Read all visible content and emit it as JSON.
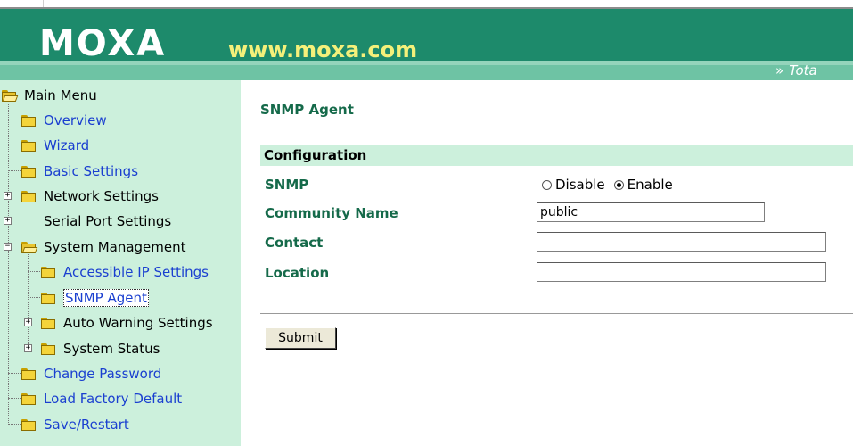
{
  "header": {
    "logo": "MOXA",
    "url": "www.moxa.com",
    "tagline": "Tota"
  },
  "sidebar": {
    "items": [
      {
        "label": "Main Menu"
      },
      {
        "label": "Overview"
      },
      {
        "label": "Wizard"
      },
      {
        "label": "Basic Settings"
      },
      {
        "label": "Network Settings"
      },
      {
        "label": "Serial Port Settings"
      },
      {
        "label": "System Management"
      },
      {
        "label": "Accessible IP Settings"
      },
      {
        "label": "SNMP Agent"
      },
      {
        "label": "Auto Warning Settings"
      },
      {
        "label": "System Status"
      },
      {
        "label": "Change Password"
      },
      {
        "label": "Load Factory Default"
      },
      {
        "label": "Save/Restart"
      }
    ]
  },
  "main": {
    "title": "SNMP Agent",
    "section": "Configuration",
    "snmp": {
      "label": "SNMP",
      "options": [
        "Disable",
        "Enable"
      ],
      "selected": "Enable"
    },
    "community": {
      "label": "Community Name",
      "value": "public"
    },
    "contact": {
      "label": "Contact",
      "value": ""
    },
    "location": {
      "label": "Location",
      "value": ""
    },
    "submit": "Submit"
  },
  "colors": {
    "header_green": "#1d8a6b",
    "band_green": "#6ec3a4",
    "sidebar_bg": "#ccf0dc",
    "label_green": "#156a4a",
    "link_blue": "#1a3fd0",
    "url_yellow": "#f4f07a"
  },
  "icons": {
    "tree_folder": "folder-icon",
    "tree_open_folder": "open-folder-icon",
    "expander": "plus-box-icon",
    "collapser": "minus-box-icon"
  }
}
